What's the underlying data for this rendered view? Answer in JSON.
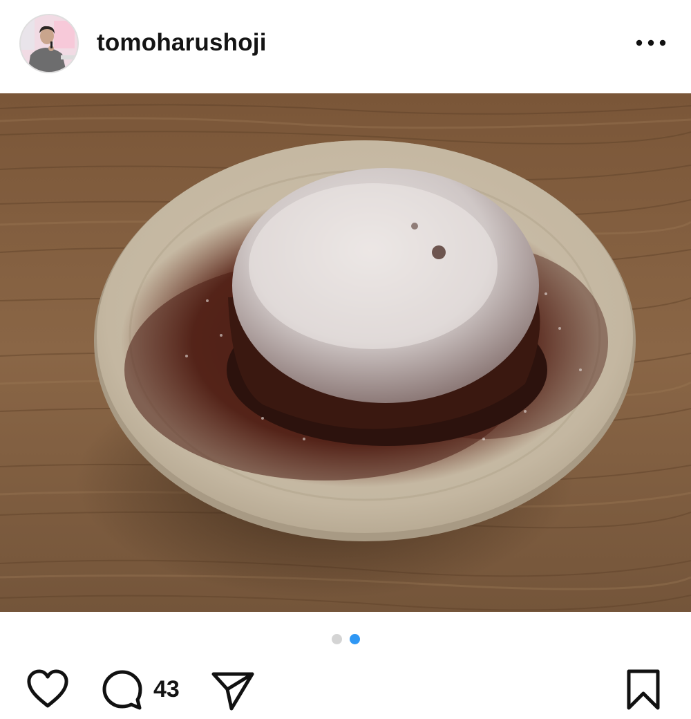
{
  "post": {
    "username": "tomoharushoji",
    "photo_alt": "chocolate cake dusted with powdered sugar and cocoa on a plate",
    "carousel": {
      "total": 2,
      "active_index": 2
    },
    "comment_count": "43"
  },
  "icons": {
    "more": "more-options-icon",
    "like": "heart-icon",
    "comment": "comment-bubble-icon",
    "share": "paper-plane-icon",
    "save": "bookmark-icon"
  },
  "colors": {
    "carousel_active": "#2f97f4",
    "carousel_inactive": "#d4d4d4",
    "text": "#141414"
  }
}
